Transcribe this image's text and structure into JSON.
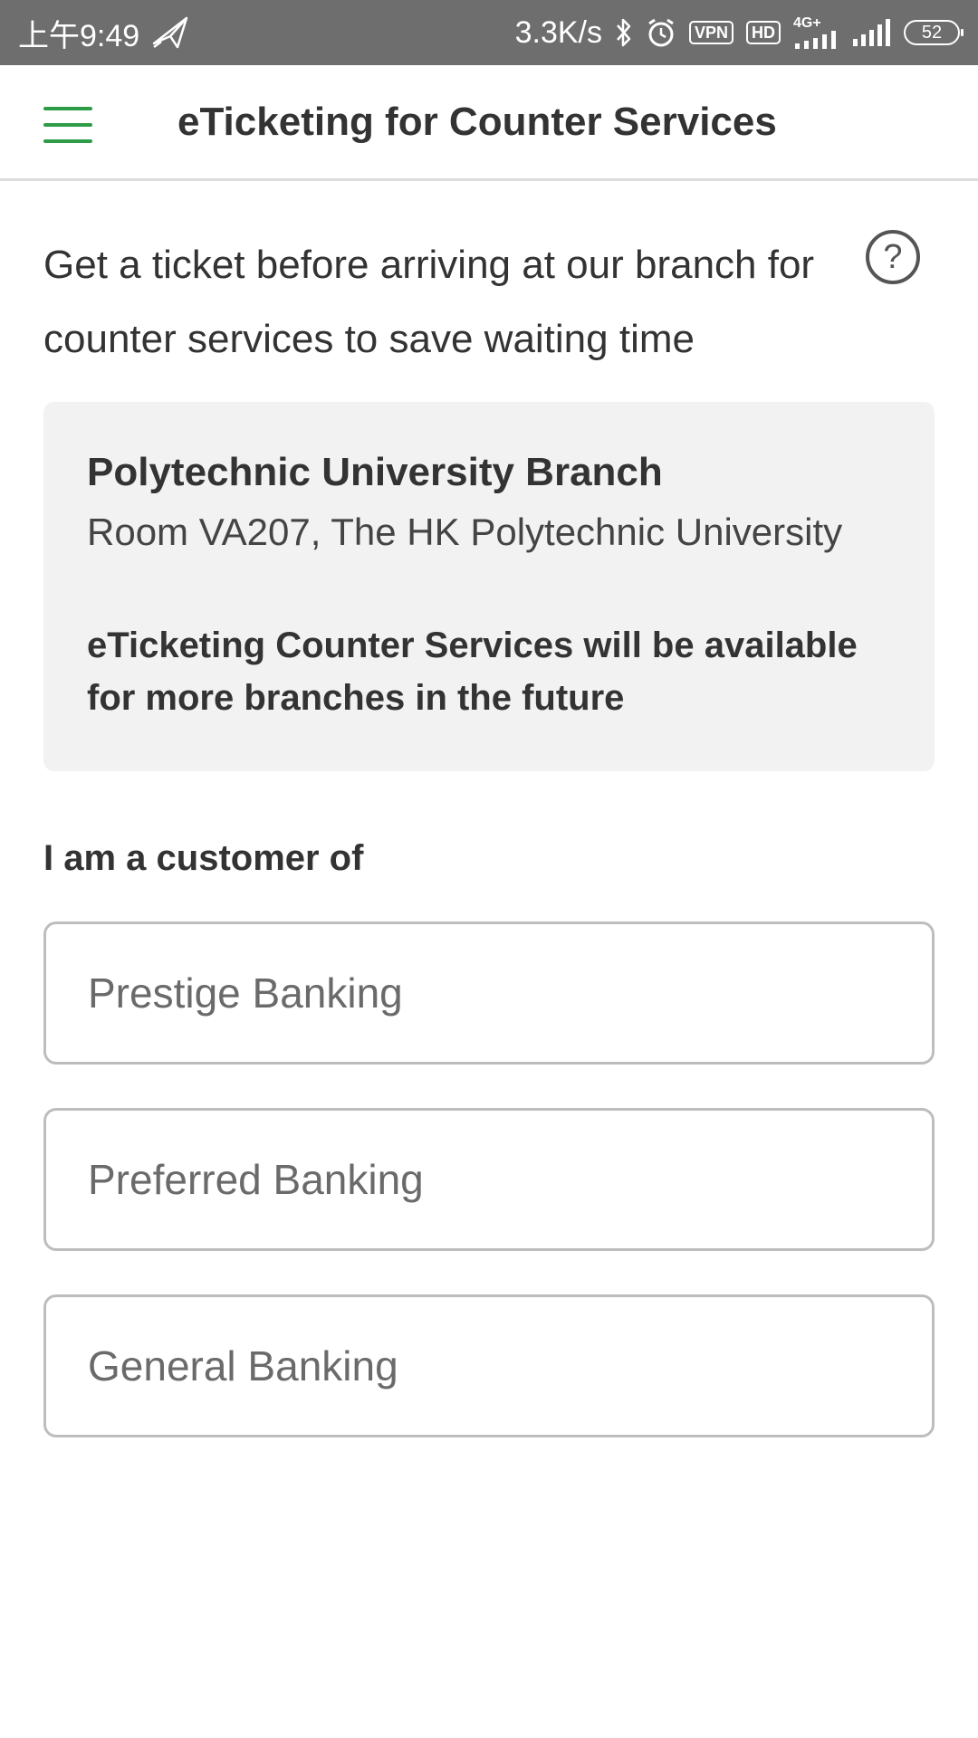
{
  "status_bar": {
    "time": "上午9:49",
    "speed": "3.3K/s",
    "vpn": "VPN",
    "hd": "HD",
    "network": "4G+",
    "battery": "52"
  },
  "header": {
    "title": "eTicketing for Counter Services"
  },
  "intro": {
    "text": "Get a ticket before arriving at our branch for counter services to save waiting time",
    "help_symbol": "?"
  },
  "branch": {
    "name": "Polytechnic University Branch",
    "address": "Room VA207, The HK Polytechnic University",
    "note": "eTicketing Counter Services will be available for more branches in the future"
  },
  "customer": {
    "label": "I am a customer of",
    "options": [
      "Prestige Banking",
      "Preferred Banking",
      "General Banking"
    ]
  },
  "colors": {
    "accent": "#2e9b46",
    "status_bar": "#6e6e6e",
    "card_background": "#f2f2f2"
  }
}
